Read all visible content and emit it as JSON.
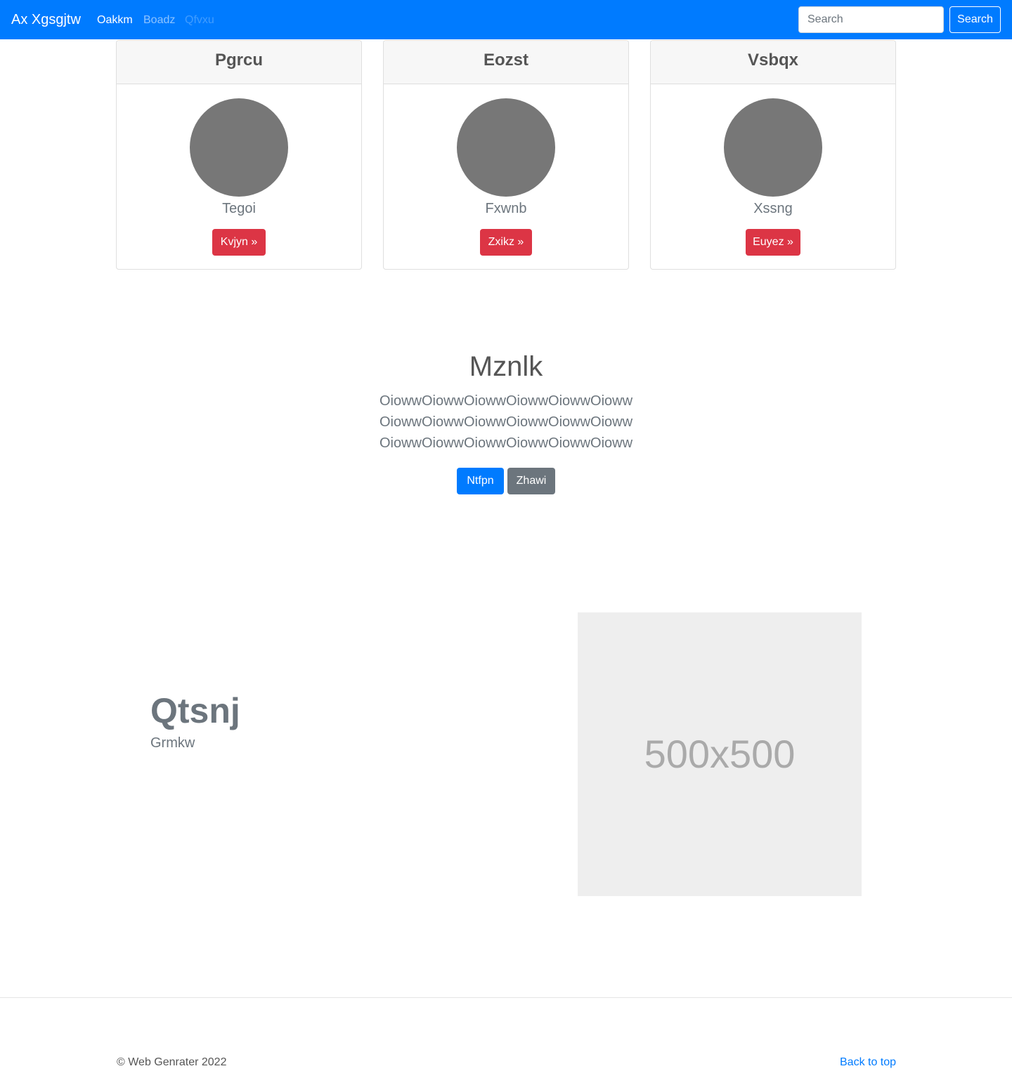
{
  "navbar": {
    "brand": "Ax Xgsgjtw",
    "links": [
      "Oakkm",
      "Boadz",
      "Qfvxu"
    ],
    "search_placeholder": "Search",
    "search_button": "Search"
  },
  "cards": [
    {
      "title": "Pgrcu",
      "text": "Tegoi",
      "button": "Kvjyn »"
    },
    {
      "title": "Eozst",
      "text": "Fxwnb",
      "button": "Zxikz »"
    },
    {
      "title": "Vsbqx",
      "text": "Xssng",
      "button": "Euyez »"
    }
  ],
  "hero": {
    "title": "Mznlk",
    "lines": [
      "OiowwOiowwOiowwOiowwOiowwOioww",
      "OiowwOiowwOiowwOiowwOiowwOioww",
      "OiowwOiowwOiowwOiowwOiowwOioww"
    ],
    "primary_button": "Ntfpn",
    "secondary_button": "Zhawi"
  },
  "feature": {
    "title": "Qtsnj",
    "subtitle": "Grmkw",
    "image_label": "500x500"
  },
  "footer": {
    "copyright": "© Web Genrater 2022",
    "back_to_top": "Back to top"
  },
  "colors": {
    "navbar": "#007bff",
    "danger": "#dc3545",
    "secondary": "#6c757d"
  }
}
